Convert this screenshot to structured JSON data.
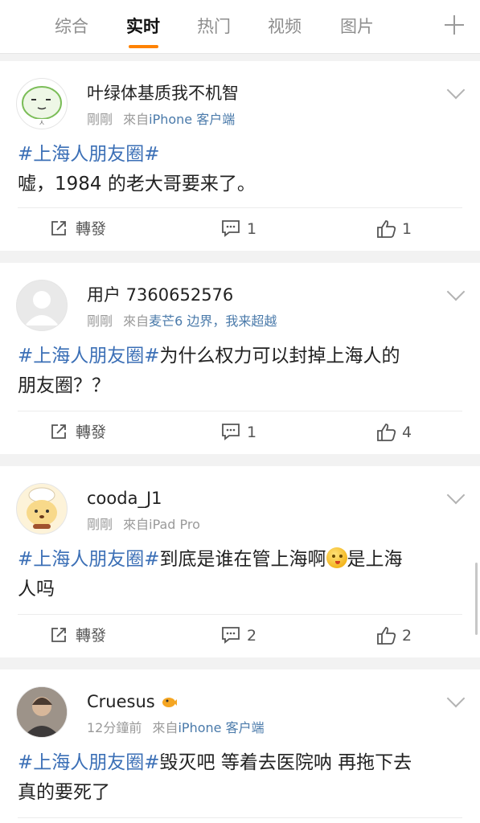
{
  "tabs": [
    "综合",
    "实时",
    "热门",
    "视频",
    "图片"
  ],
  "active_tab_index": 1,
  "accent_color": "#ff8200",
  "link_color": "#3b6fb6",
  "posts": [
    {
      "username": "叶绿体基质我不机智",
      "time": "剛剛",
      "from_prefix": "來自",
      "source": "iPhone 客户端",
      "hashtag": "#上海人朋友圈#",
      "text_line1": "",
      "text_line2": "嘘，1984 的老大哥要来了。",
      "repost_label": "轉發",
      "comments": "1",
      "likes": "1"
    },
    {
      "username": "用户 7360652576",
      "time": "剛剛",
      "from_prefix": "來自",
      "source": "麦芒6 边界，我来超越",
      "hashtag": "#上海人朋友圈#",
      "text_line1": "为什么权力可以封掉上海人的",
      "text_line2": "朋友圈？？",
      "repost_label": "轉發",
      "comments": "1",
      "likes": "4"
    },
    {
      "username": "cooda_J1",
      "time": "剛剛",
      "from_prefix": "來自",
      "source": "iPad Pro",
      "hashtag": "#上海人朋友圈#",
      "text_line1a": "到底是谁在管上海啊",
      "text_line1b": "是上海",
      "text_line2": "人吗",
      "repost_label": "轉發",
      "comments": "2",
      "likes": "2"
    },
    {
      "username": "Cruesus",
      "time": "12分鐘前",
      "from_prefix": "來自",
      "source": "iPhone 客户端",
      "hashtag": "#上海人朋友圈#",
      "text_line1": "毁灭吧 等着去医院呐 再拖下去",
      "text_line2": "真的要死了"
    }
  ],
  "icons": {
    "repost": "share-icon",
    "comment": "comment-icon",
    "like": "thumbs-up-icon",
    "more": "chevron-down-icon",
    "add": "plus-icon"
  }
}
